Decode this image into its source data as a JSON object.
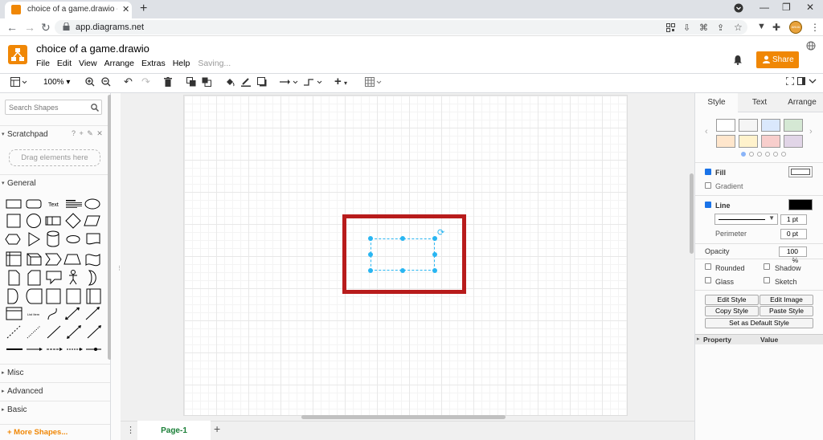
{
  "browser": {
    "tab_title": "choice of a game.drawio - diagra",
    "tab_close": "✕",
    "new_tab": "+",
    "url": "app.diagrams.net",
    "window_buttons": [
      "⌄",
      "—",
      "❐",
      "✕"
    ],
    "avatar_text": "ANVA"
  },
  "app": {
    "title": "choice of a game.drawio",
    "menu": [
      "File",
      "Edit",
      "View",
      "Arrange",
      "Extras",
      "Help"
    ],
    "status": "Saving...",
    "share_label": "Share",
    "accent_color": "#f08705"
  },
  "toolbar": {
    "zoom": "100%"
  },
  "left_panel": {
    "search_placeholder": "Search Shapes",
    "scratchpad_label": "Scratchpad",
    "scratchpad_icons": "? + ✎ ✕",
    "drop_label": "Drag elements here",
    "general_label": "General",
    "text_shape": "Text",
    "list_item_shape": "List Item",
    "sections": [
      "Misc",
      "Advanced",
      "Basic"
    ],
    "more_shapes": "+ More Shapes..."
  },
  "pages": {
    "active": "Page-1",
    "add": "+"
  },
  "right_panel": {
    "tabs": [
      "Style",
      "Text",
      "Arrange"
    ],
    "swatch_colors": [
      "#ffffff",
      "#f5f5f5",
      "#dae8fc",
      "#d5e8d4",
      "#ffe6cc",
      "#fff2cc",
      "#f8cecc",
      "#e1d5e7"
    ],
    "fill_label": "Fill",
    "gradient_label": "Gradient",
    "line_label": "Line",
    "line_width": "1 pt",
    "perimeter_label": "Perimeter",
    "perimeter_value": "0 pt",
    "opacity_label": "Opacity",
    "opacity_value": "100 %",
    "rounded_label": "Rounded",
    "shadow_label": "Shadow",
    "glass_label": "Glass",
    "sketch_label": "Sketch",
    "edit_style": "Edit Style",
    "edit_image": "Edit Image",
    "copy_style": "Copy Style",
    "paste_style": "Paste Style",
    "set_default": "Set as Default Style",
    "property_header": "Property",
    "value_header": "Value"
  }
}
